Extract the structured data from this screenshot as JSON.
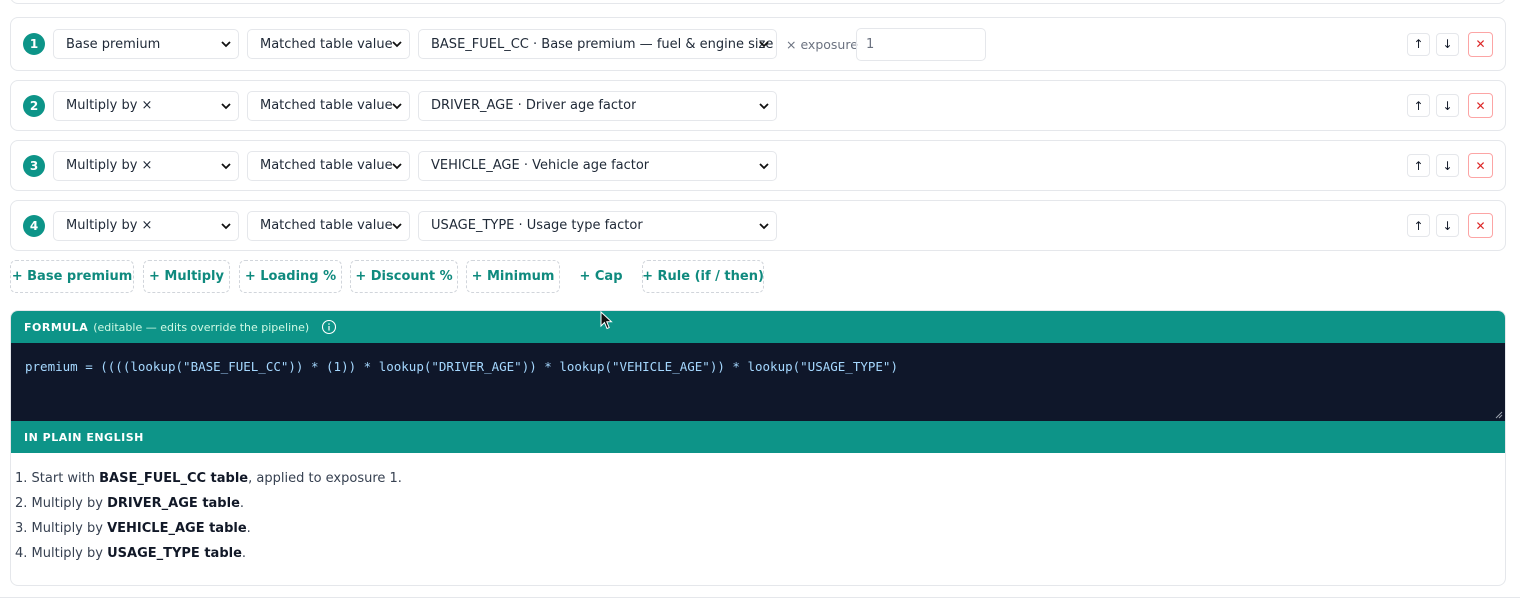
{
  "steps": [
    {
      "num": "1",
      "kind": "Base premium",
      "source": "Matched table value",
      "table": "BASE_FUEL_CC · Base premium — fuel & engine size",
      "exposure_label": "× exposure",
      "exposure_value": "1"
    },
    {
      "num": "2",
      "kind": "Multiply by ×",
      "source": "Matched table value",
      "table": "DRIVER_AGE · Driver age factor"
    },
    {
      "num": "3",
      "kind": "Multiply by ×",
      "source": "Matched table value",
      "table": "VEHICLE_AGE · Vehicle age factor"
    },
    {
      "num": "4",
      "kind": "Multiply by ×",
      "source": "Matched table value",
      "table": "USAGE_TYPE · Usage type factor"
    }
  ],
  "row_buttons": {
    "up": "↑",
    "down": "↓",
    "delete": "✕"
  },
  "add_buttons": [
    "+ Base premium",
    "+ Multiply",
    "+ Loading %",
    "+ Discount %",
    "+ Minimum",
    "+ Cap",
    "+ Rule (if / then)"
  ],
  "formula": {
    "heading": "FORMULA",
    "subheading": "(editable — edits override the pipeline)",
    "code": "premium = ((((lookup(\"BASE_FUEL_CC\")) * (1)) * lookup(\"DRIVER_AGE\")) * lookup(\"VEHICLE_AGE\")) * lookup(\"USAGE_TYPE\")"
  },
  "plain_english": {
    "heading": "IN PLAIN ENGLISH",
    "items": [
      {
        "prefix": "1. Start with ",
        "bold": "BASE_FUEL_CC table",
        "suffix": ", applied to exposure 1."
      },
      {
        "prefix": "2. Multiply by ",
        "bold": "DRIVER_AGE table",
        "suffix": "."
      },
      {
        "prefix": "3. Multiply by ",
        "bold": "VEHICLE_AGE table",
        "suffix": "."
      },
      {
        "prefix": "4. Multiply by ",
        "bold": "USAGE_TYPE table",
        "suffix": "."
      }
    ]
  },
  "icons": {
    "chevron": "chevron-down-icon",
    "info": "info-icon",
    "cursor": "mouse-cursor-icon"
  },
  "colors": {
    "accent": "#0d9488",
    "code_bg": "#0f172a",
    "danger": "#dc2626"
  }
}
